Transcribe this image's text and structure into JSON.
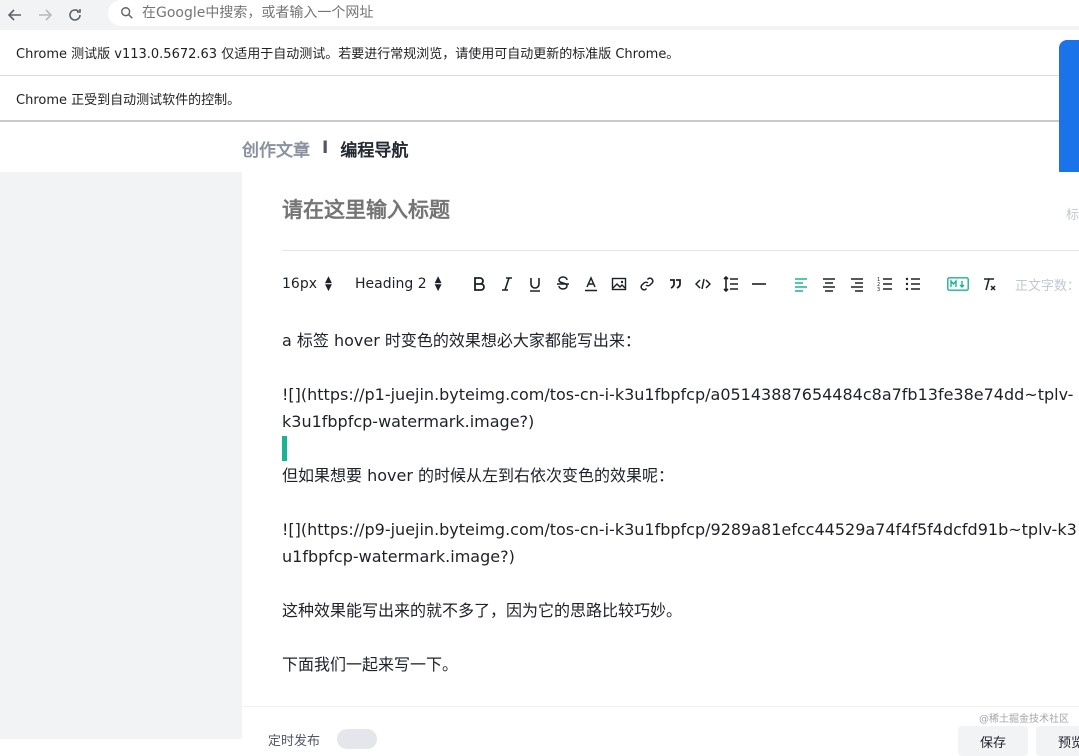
{
  "browser": {
    "omnibox_placeholder": "在Google中搜索，或者输入一个网址",
    "info_bar_1": "Chrome 测试版 v113.0.5672.63 仅适用于自动测试。若要进行常规浏览，请使用可自动更新的标准版 Chrome。",
    "info_bar_2": "Chrome 正受到自动测试软件的控制。"
  },
  "header": {
    "brand": "创作文章",
    "separator": "I",
    "site": "编程导航"
  },
  "editor": {
    "title_placeholder": "请在这里输入标题",
    "title_tip": "标",
    "toolbar": {
      "font_size": "16px",
      "heading": "Heading 2",
      "word_count_label": "正文字数："
    },
    "content": {
      "p1": "a 标签 hover 时变色的效果想必大家都能写出来：",
      "p2": "![](https://p1-juejin.byteimg.com/tos-cn-i-k3u1fbpfcp/a05143887654484c8a7fb13fe38e74dd~tplv-k3u1fbpfcp-watermark.image?)",
      "p3": "但如果想要 hover 的时候从左到右依次变色的效果呢：",
      "p4": "![](https://p9-juejin.byteimg.com/tos-cn-i-k3u1fbpfcp/9289a81efcc44529a74f4f5f4dcfd91b~tplv-k3u1fbpfcp-watermark.image?)",
      "p5": "这种效果能写出来的就不多了，因为它的思路比较巧妙。",
      "p6": "下面我们一起来写一下。"
    }
  },
  "footer": {
    "watermark": "@稀土掘金技术社区",
    "timed_publish": "定时发布",
    "save": "保存",
    "preview": "预览"
  },
  "colors": {
    "accent": "#1ab394",
    "chrome_blue": "#1a73e8"
  }
}
